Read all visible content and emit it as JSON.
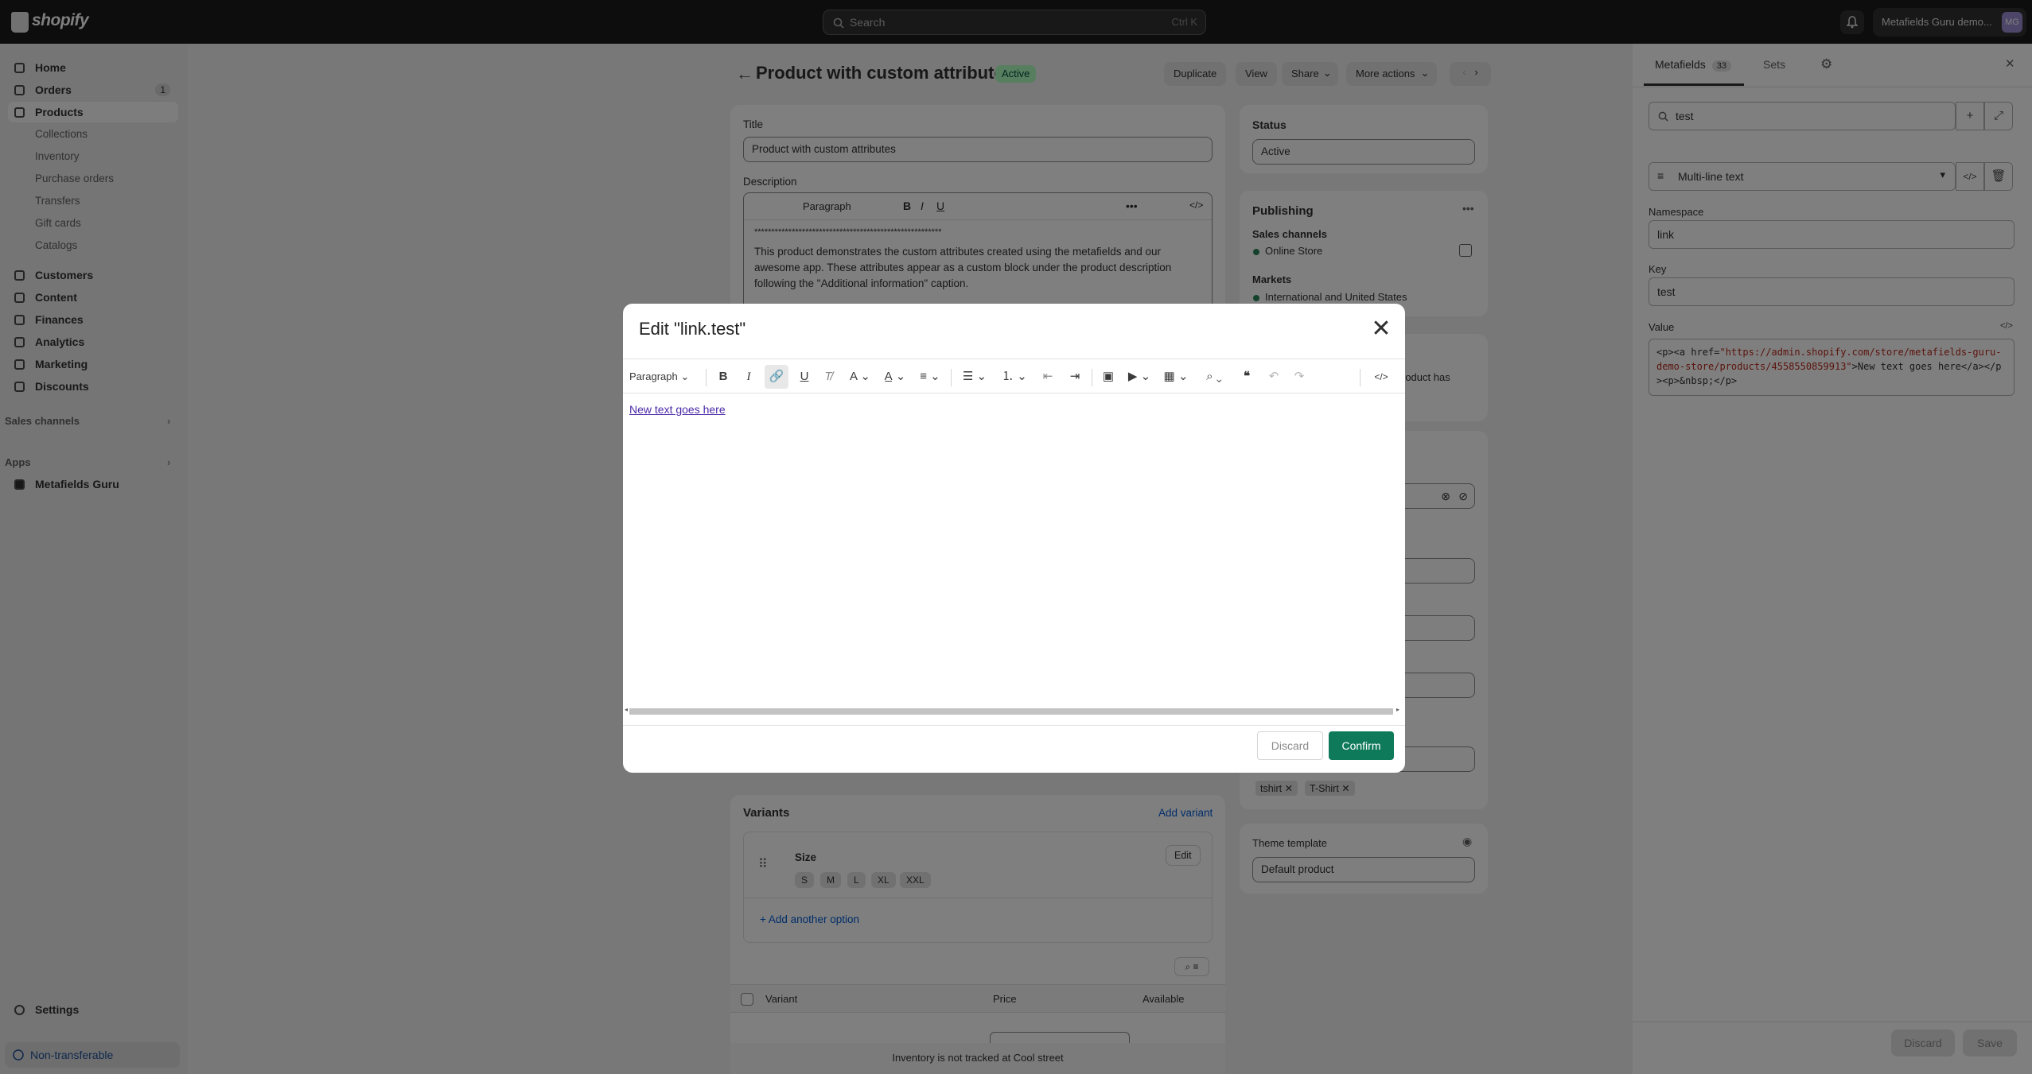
{
  "topbar": {
    "logo": "shopify",
    "search_placeholder": "Search",
    "search_shortcut": "Ctrl K",
    "store_name": "Metafields Guru demo...",
    "avatar_initials": "MG"
  },
  "sidebar": {
    "items": [
      {
        "label": "Home"
      },
      {
        "label": "Orders",
        "badge": "1"
      },
      {
        "label": "Products"
      },
      {
        "label": "Collections"
      },
      {
        "label": "Inventory"
      },
      {
        "label": "Purchase orders"
      },
      {
        "label": "Transfers"
      },
      {
        "label": "Gift cards"
      },
      {
        "label": "Catalogs"
      },
      {
        "label": "Customers"
      },
      {
        "label": "Content"
      },
      {
        "label": "Finances"
      },
      {
        "label": "Analytics"
      },
      {
        "label": "Marketing"
      },
      {
        "label": "Discounts"
      }
    ],
    "sales_channels": "Sales channels",
    "apps": "Apps",
    "app_item": "Metafields Guru",
    "settings": "Settings",
    "non_transferable": "Non-transferable"
  },
  "page": {
    "title": "Product with custom attributes",
    "status_badge": "Active",
    "buttons": {
      "duplicate": "Duplicate",
      "view": "View",
      "share": "Share",
      "more": "More actions"
    },
    "title_label": "Title",
    "title_value": "Product with custom attributes",
    "description_label": "Description",
    "desc_toolbar_paragraph": "Paragraph",
    "desc_line0": "*******************************************************",
    "desc_text": "This product demonstrates the custom attributes created using the metafields and our awesome app. These attributes appear as a custom block under the product description following the \"Additional information\" caption.",
    "status_label": "Status",
    "status_value": "Active",
    "publishing": "Publishing",
    "sales_channels": "Sales channels",
    "online_store": "Online Store",
    "markets": "Markets",
    "markets_value": "International and United States",
    "partial_text": "roduct has",
    "tags": [
      "tshirt",
      "T-Shirt"
    ],
    "theme_template_label": "Theme template",
    "theme_template_value": "Default product",
    "variants_title": "Variants",
    "add_variant": "Add variant",
    "option_name": "Size",
    "option_edit": "Edit",
    "sizes": [
      "S",
      "M",
      "L",
      "XL",
      "XXL"
    ],
    "add_option": "+ Add another option",
    "table_headers": {
      "variant": "Variant",
      "price": "Price",
      "available": "Available"
    },
    "inventory_note": "Inventory is not tracked at Cool street"
  },
  "rpanel": {
    "tab_metafields": "Metafields",
    "tab_count": "33",
    "tab_sets": "Sets",
    "search_value": "test",
    "type_value": "Multi-line text",
    "namespace_label": "Namespace",
    "namespace_value": "link",
    "key_label": "Key",
    "key_value": "test",
    "value_label": "Value",
    "code_p": "<p><a href=",
    "code_url": "\"https://admin.shopify.com/store/metafields-guru-demo-store/products/4558550859913\"",
    "code_rest": ">New text goes here</a></p><p>&nbsp;</p>",
    "discard": "Discard",
    "save": "Save"
  },
  "modal": {
    "title": "Edit \"link.test\"",
    "paragraph": "Paragraph",
    "link_text": "New text goes here",
    "discard": "Discard",
    "confirm": "Confirm"
  }
}
